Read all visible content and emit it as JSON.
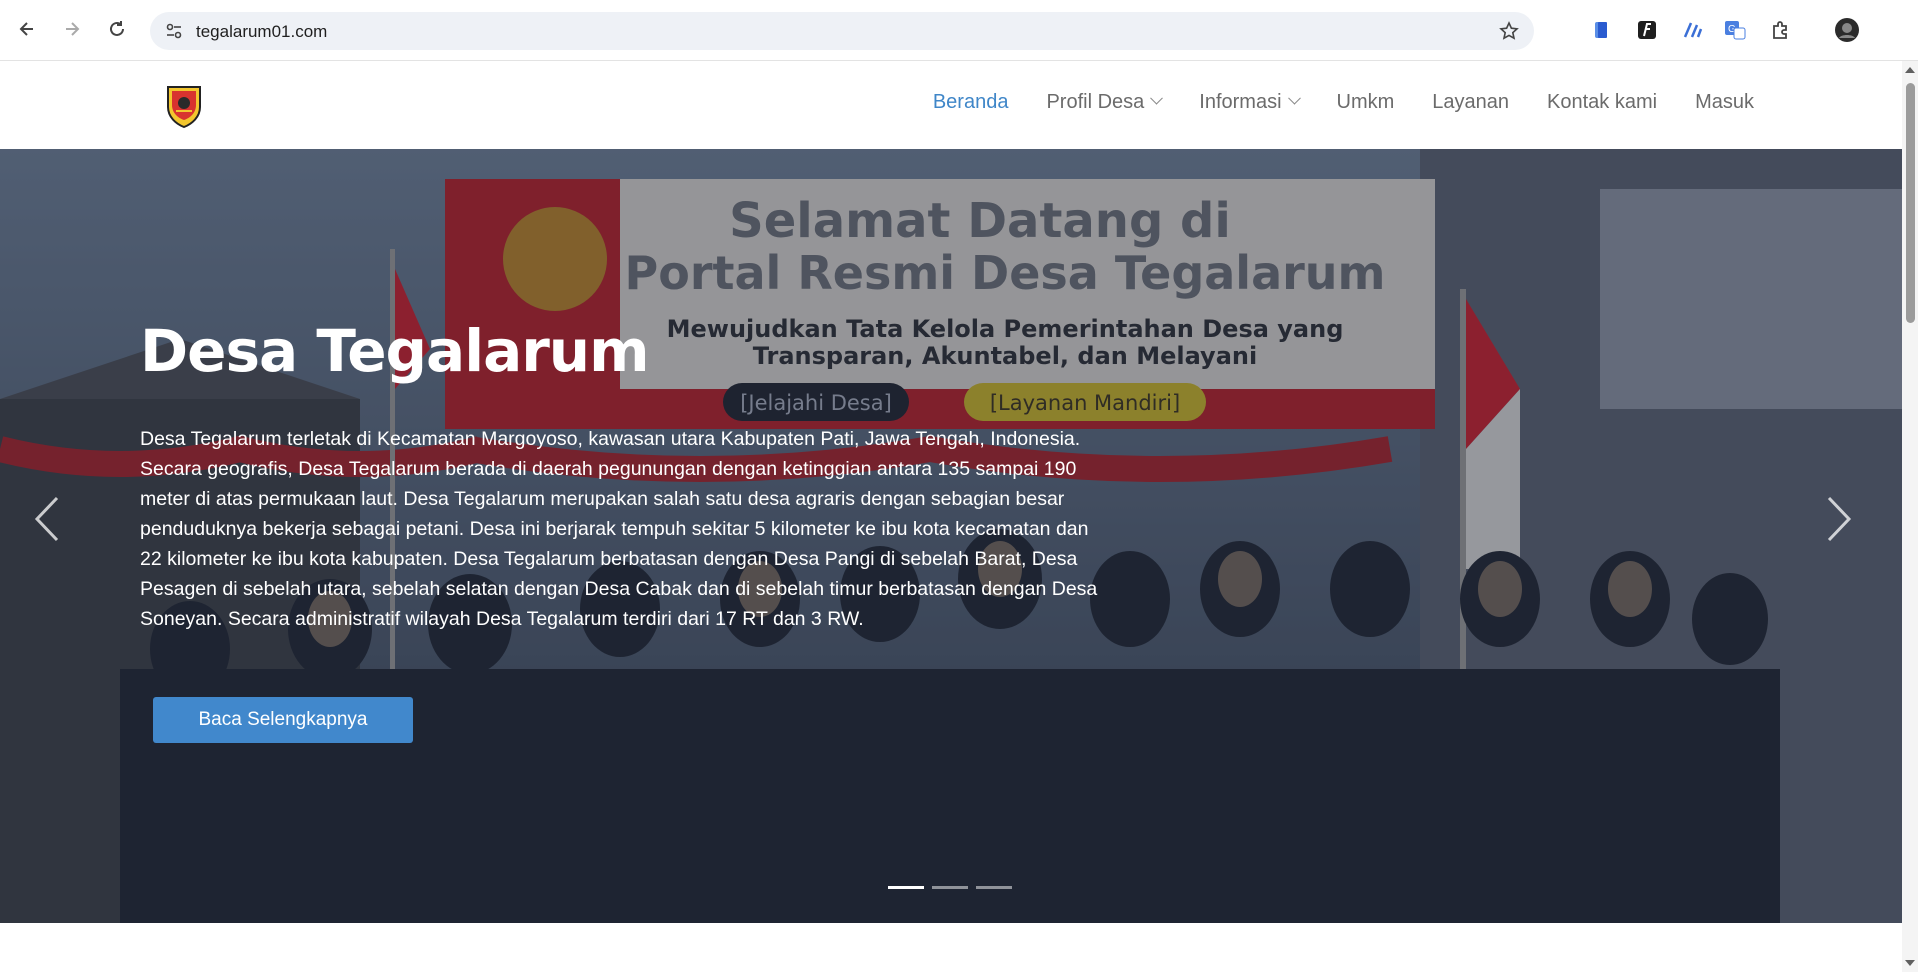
{
  "browser": {
    "url": "tegalarum01.com",
    "icons": [
      "back-icon",
      "forward-icon",
      "reload-icon",
      "site-settings-icon",
      "bookmark-star-icon",
      "extension-icon",
      "extensions-puzzle-icon",
      "profile-avatar"
    ]
  },
  "nav": {
    "items": [
      {
        "label": "Beranda",
        "dropdown": false,
        "active": true
      },
      {
        "label": "Profil Desa",
        "dropdown": true,
        "active": false
      },
      {
        "label": "Informasi",
        "dropdown": true,
        "active": false
      },
      {
        "label": "Umkm",
        "dropdown": false,
        "active": false
      },
      {
        "label": "Layanan",
        "dropdown": false,
        "active": false
      },
      {
        "label": "Kontak kami",
        "dropdown": false,
        "active": false
      },
      {
        "label": "Masuk",
        "dropdown": false,
        "active": false
      }
    ]
  },
  "hero": {
    "title": "Desa Tegalarum",
    "description": "Desa Tegalarum terletak di Kecamatan Margoyoso, kawasan utara Kabupaten Pati, Jawa Tengah, Indonesia. Secara geografis, Desa Tegalarum berada di daerah pegunungan dengan ketinggian antara 135 sampai 190 meter di atas permukaan laut. Desa Tegalarum merupakan salah satu desa agraris dengan sebagian besar penduduknya bekerja sebagai petani. Desa ini berjarak tempuh sekitar 5 kilometer ke ibu kota kecamatan dan 22 kilometer ke ibu kota kabupaten. Desa Tegalarum berbatasan dengan Desa Pangi di sebelah Barat, Desa Pesagen di sebelah utara, sebelah selatan dengan Desa Cabak dan di sebelah timur berbatasan dengan Desa Soneyan. Secara administratif wilayah Desa Tegalarum terdiri dari 17 RT dan 3 RW.",
    "cta_label": "Baca Selengkapnya",
    "banner": {
      "line1": "Selamat Datang di",
      "line2": "Portal Resmi Desa Tegalarum",
      "line3": "Mewujudkan Tata Kelola Pemerintahan Desa yang",
      "line4": "Transparan, Akuntabel, dan Melayani",
      "btn1": "[Jelajahi Desa]",
      "btn2": "[Layanan Mandiri]"
    },
    "slides": 3,
    "active_slide": 0
  },
  "colors": {
    "accent": "#4188cc",
    "nav_active": "#3f86c8",
    "banner_red": "#c8202e"
  }
}
